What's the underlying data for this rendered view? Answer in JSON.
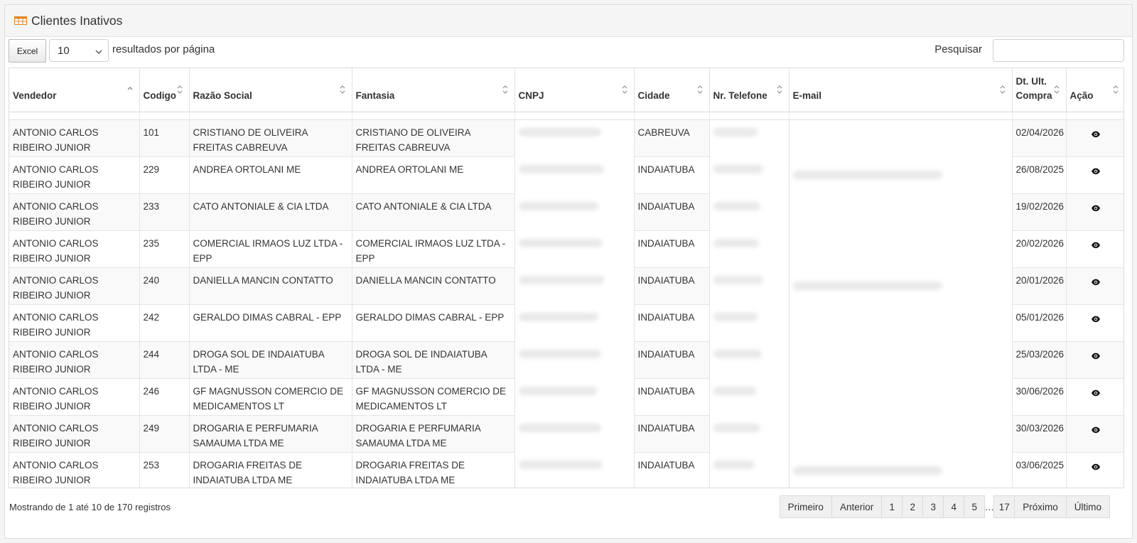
{
  "panel": {
    "title": "Clientes Inativos",
    "icon": "table-icon"
  },
  "toolbar": {
    "excel_label": "Excel",
    "length_value": "10",
    "per_page_label": "resultados por página",
    "search_label": "Pesquisar",
    "search_value": ""
  },
  "table": {
    "headers": [
      "Vendedor",
      "Codigo",
      "Razão Social",
      "Fantasia",
      "CNPJ",
      "Cidade",
      "Nr. Telefone",
      "E-mail",
      "Dt. Ult. Compra",
      "Ação"
    ],
    "rows": [
      {
        "vendedor": "ANTONIO CARLOS RIBEIRO JUNIOR",
        "codigo": "101",
        "razao": "CRISTIANO DE OLIVEIRA FREITAS CABREUVA",
        "fantasia": "CRISTIANO DE OLIVEIRA FREITAS CABREUVA",
        "cidade": "CABREUVA",
        "email_visible": false,
        "data": "02/04/2026"
      },
      {
        "vendedor": "ANTONIO CARLOS RIBEIRO JUNIOR",
        "codigo": "229",
        "razao": "ANDREA ORTOLANI ME",
        "fantasia": "ANDREA ORTOLANI ME",
        "cidade": "INDAIATUBA",
        "email_visible": true,
        "data": "26/08/2025"
      },
      {
        "vendedor": "ANTONIO CARLOS RIBEIRO JUNIOR",
        "codigo": "233",
        "razao": "CATO ANTONIALE & CIA LTDA",
        "fantasia": "CATO ANTONIALE & CIA LTDA",
        "cidade": "INDAIATUBA",
        "email_visible": false,
        "data": "19/02/2026"
      },
      {
        "vendedor": "ANTONIO CARLOS RIBEIRO JUNIOR",
        "codigo": "235",
        "razao": "COMERCIAL IRMAOS LUZ LTDA - EPP",
        "fantasia": "COMERCIAL IRMAOS LUZ LTDA - EPP",
        "cidade": "INDAIATUBA",
        "email_visible": false,
        "data": "20/02/2026"
      },
      {
        "vendedor": "ANTONIO CARLOS RIBEIRO JUNIOR",
        "codigo": "240",
        "razao": "DANIELLA MANCIN CONTATTO",
        "fantasia": "DANIELLA MANCIN CONTATTO",
        "cidade": "INDAIATUBA",
        "email_visible": true,
        "data": "20/01/2026"
      },
      {
        "vendedor": "ANTONIO CARLOS RIBEIRO JUNIOR",
        "codigo": "242",
        "razao": "GERALDO DIMAS CABRAL - EPP",
        "fantasia": "GERALDO DIMAS CABRAL - EPP",
        "cidade": "INDAIATUBA",
        "email_visible": false,
        "data": "05/01/2026"
      },
      {
        "vendedor": "ANTONIO CARLOS RIBEIRO JUNIOR",
        "codigo": "244",
        "razao": "DROGA SOL DE INDAIATUBA LTDA - ME",
        "fantasia": "DROGA SOL DE INDAIATUBA LTDA - ME",
        "cidade": "INDAIATUBA",
        "email_visible": false,
        "data": "25/03/2026"
      },
      {
        "vendedor": "ANTONIO CARLOS RIBEIRO JUNIOR",
        "codigo": "246",
        "razao": "GF MAGNUSSON COMERCIO DE MEDICAMENTOS LT",
        "fantasia": "GF MAGNUSSON COMERCIO DE MEDICAMENTOS LT",
        "cidade": "INDAIATUBA",
        "email_visible": false,
        "data": "30/06/2026"
      },
      {
        "vendedor": "ANTONIO CARLOS RIBEIRO JUNIOR",
        "codigo": "249",
        "razao": "DROGARIA E PERFUMARIA SAMAUMA LTDA ME",
        "fantasia": "DROGARIA E PERFUMARIA SAMAUMA LTDA ME",
        "cidade": "INDAIATUBA",
        "email_visible": false,
        "data": "30/03/2026"
      },
      {
        "vendedor": "ANTONIO CARLOS RIBEIRO JUNIOR",
        "codigo": "253",
        "razao": "DROGARIA FREITAS DE INDAIATUBA LTDA ME",
        "fantasia": "DROGARIA FREITAS DE INDAIATUBA LTDA ME",
        "cidade": "INDAIATUBA",
        "email_visible": true,
        "data": "03/06/2025"
      }
    ]
  },
  "footer": {
    "info": "Mostrando de 1 até 10 de 170 registros",
    "pagination": {
      "first": "Primeiro",
      "prev": "Anterior",
      "pages": [
        "1",
        "2",
        "3",
        "4",
        "5"
      ],
      "ellipsis": "…",
      "last_page": "17",
      "next": "Próximo",
      "last": "Último"
    }
  },
  "colors": {
    "accent_icon": "#e0862a",
    "header_bg": "#f5f5f5",
    "pager_bg": "#f0f0f0"
  }
}
